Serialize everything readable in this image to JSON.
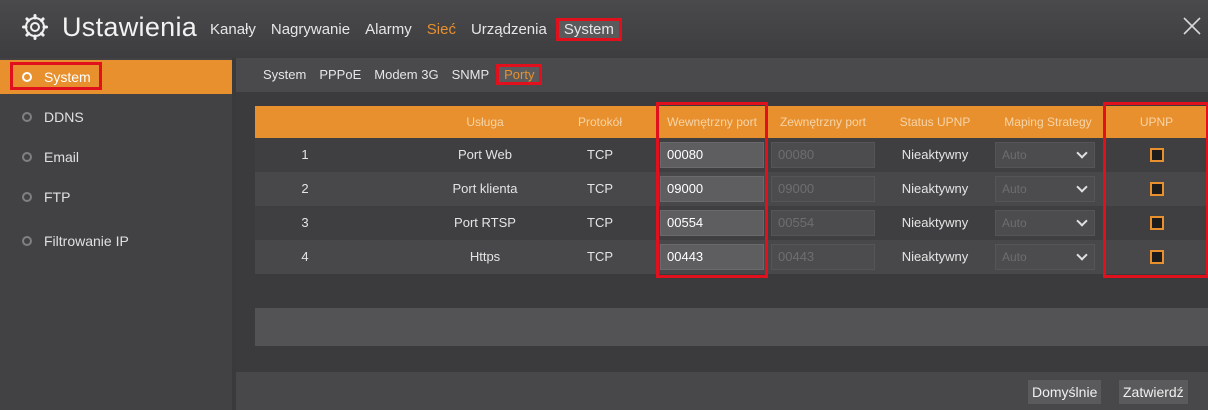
{
  "header": {
    "title": "Ustawienia",
    "close_icon": "close-icon",
    "gear_icon": "gear-icon",
    "tabs": [
      {
        "label": "Kanały",
        "active": false
      },
      {
        "label": "Nagrywanie",
        "active": false
      },
      {
        "label": "Alarmy",
        "active": false
      },
      {
        "label": "Sieć",
        "active": true
      },
      {
        "label": "Urządzenia",
        "active": false
      },
      {
        "label": "System",
        "active": false,
        "highlighted": true
      }
    ]
  },
  "sidebar": {
    "items": [
      {
        "label": "System",
        "active": true
      },
      {
        "label": "DDNS",
        "active": false
      },
      {
        "label": "Email",
        "active": false
      },
      {
        "label": "FTP",
        "active": false
      },
      {
        "label": "Filtrowanie IP",
        "active": false
      }
    ]
  },
  "subtabs": [
    {
      "label": "System",
      "active": false
    },
    {
      "label": "PPPoE",
      "active": false
    },
    {
      "label": "Modem 3G",
      "active": false
    },
    {
      "label": "SNMP",
      "active": false
    },
    {
      "label": "Porty",
      "active": true
    }
  ],
  "table": {
    "headers": [
      "",
      "Usługa",
      "Protokół",
      "Wewnętrzny port",
      "Zewnętrzny port",
      "Status UPNP",
      "Maping Strategy",
      "UPNP"
    ],
    "rows": [
      {
        "num": "1",
        "service": "Port Web",
        "protocol": "TCP",
        "internal": "00080",
        "external": "00080",
        "status": "Nieaktywny",
        "strategy": "Auto",
        "upnp": false
      },
      {
        "num": "2",
        "service": "Port klienta",
        "protocol": "TCP",
        "internal": "09000",
        "external": "09000",
        "status": "Nieaktywny",
        "strategy": "Auto",
        "upnp": false
      },
      {
        "num": "3",
        "service": "Port RTSP",
        "protocol": "TCP",
        "internal": "00554",
        "external": "00554",
        "status": "Nieaktywny",
        "strategy": "Auto",
        "upnp": false
      },
      {
        "num": "4",
        "service": "Https",
        "protocol": "TCP",
        "internal": "00443",
        "external": "00443",
        "status": "Nieaktywny",
        "strategy": "Auto",
        "upnp": false
      }
    ]
  },
  "footer": {
    "default_label": "Domyślnie",
    "apply_label": "Zatwierdź"
  },
  "colors": {
    "accent": "#e8902e",
    "highlight": "#e0101c",
    "background": "#3a3a3c"
  }
}
